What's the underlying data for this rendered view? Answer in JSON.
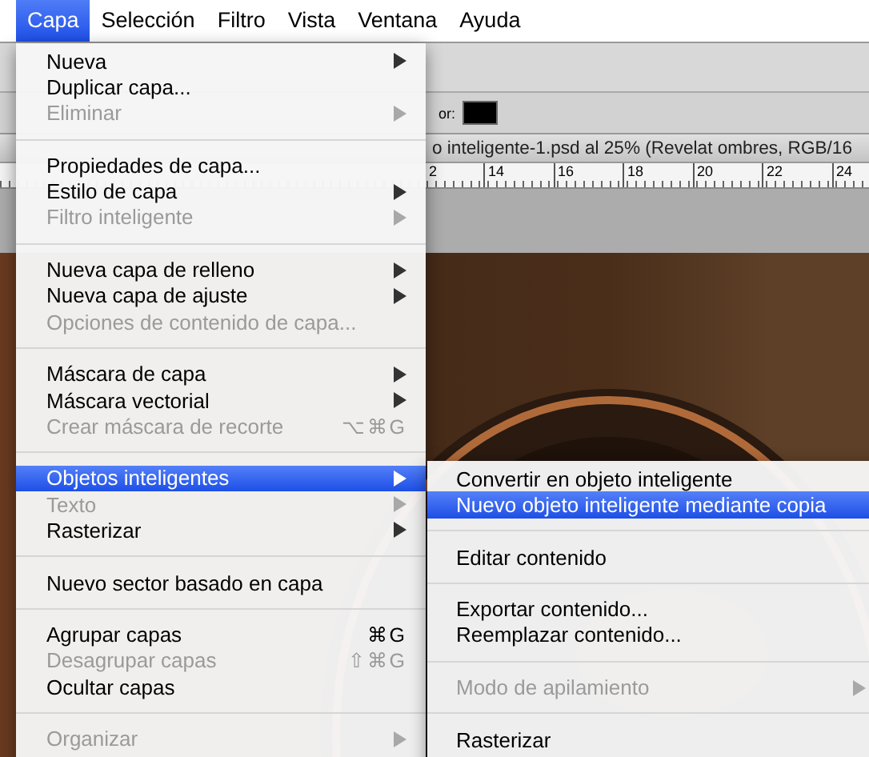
{
  "menu_bar": [
    {
      "label": "Capa",
      "selected": true
    },
    {
      "label": "Selección",
      "selected": false
    },
    {
      "label": "Filtro",
      "selected": false
    },
    {
      "label": "Vista",
      "selected": false
    },
    {
      "label": "Ventana",
      "selected": false
    },
    {
      "label": "Ayuda",
      "selected": false
    }
  ],
  "document": {
    "options_label": "or:",
    "title": "o inteligente-1.psd al 25% (Revelat ombres, RGB/16",
    "ruler_ticks": [
      "2",
      "14",
      "16",
      "18",
      "20",
      "22",
      "24"
    ]
  },
  "menu": {
    "items": [
      {
        "kind": "item",
        "label": "Nueva",
        "disabled": false,
        "submenu": true,
        "selected": false
      },
      {
        "kind": "item",
        "label": "Duplicar capa...",
        "disabled": false,
        "submenu": false,
        "selected": false
      },
      {
        "kind": "item",
        "label": "Eliminar",
        "disabled": true,
        "submenu": true,
        "selected": false
      },
      {
        "kind": "separator"
      },
      {
        "kind": "item",
        "label": "Propiedades de capa...",
        "disabled": false,
        "submenu": false,
        "selected": false
      },
      {
        "kind": "item",
        "label": "Estilo de capa",
        "disabled": false,
        "submenu": true,
        "selected": false
      },
      {
        "kind": "item",
        "label": "Filtro inteligente",
        "disabled": true,
        "submenu": true,
        "selected": false
      },
      {
        "kind": "separator"
      },
      {
        "kind": "item",
        "label": "Nueva capa de relleno",
        "disabled": false,
        "submenu": true,
        "selected": false
      },
      {
        "kind": "item",
        "label": "Nueva capa de ajuste",
        "disabled": false,
        "submenu": true,
        "selected": false
      },
      {
        "kind": "item",
        "label": "Opciones de contenido de capa...",
        "disabled": true,
        "submenu": false,
        "selected": false
      },
      {
        "kind": "separator"
      },
      {
        "kind": "item",
        "label": "Máscara de capa",
        "disabled": false,
        "submenu": true,
        "selected": false
      },
      {
        "kind": "item",
        "label": "Máscara vectorial",
        "disabled": false,
        "submenu": true,
        "selected": false
      },
      {
        "kind": "item",
        "label": "Crear máscara de recorte",
        "disabled": true,
        "submenu": false,
        "selected": false,
        "shortcut": "⌥⌘G"
      },
      {
        "kind": "separator"
      },
      {
        "kind": "item",
        "label": "Objetos inteligentes",
        "disabled": false,
        "submenu": true,
        "selected": true
      },
      {
        "kind": "item",
        "label": "Texto",
        "disabled": true,
        "submenu": true,
        "selected": false
      },
      {
        "kind": "item",
        "label": "Rasterizar",
        "disabled": false,
        "submenu": true,
        "selected": false
      },
      {
        "kind": "separator"
      },
      {
        "kind": "item",
        "label": "Nuevo sector basado en capa",
        "disabled": false,
        "submenu": false,
        "selected": false
      },
      {
        "kind": "separator"
      },
      {
        "kind": "item",
        "label": "Agrupar capas",
        "disabled": false,
        "submenu": false,
        "selected": false,
        "shortcut": "⌘G"
      },
      {
        "kind": "item",
        "label": "Desagrupar capas",
        "disabled": true,
        "submenu": false,
        "selected": false,
        "shortcut": "⇧⌘G"
      },
      {
        "kind": "item",
        "label": "Ocultar capas",
        "disabled": false,
        "submenu": false,
        "selected": false
      },
      {
        "kind": "separator"
      },
      {
        "kind": "item",
        "label": "Organizar",
        "disabled": true,
        "submenu": true,
        "selected": false
      }
    ]
  },
  "submenu": {
    "items": [
      {
        "kind": "item",
        "label": "Convertir en objeto inteligente",
        "disabled": false,
        "submenu": false,
        "selected": false
      },
      {
        "kind": "item",
        "label": "Nuevo objeto inteligente mediante copia",
        "disabled": false,
        "submenu": false,
        "selected": true
      },
      {
        "kind": "separator"
      },
      {
        "kind": "item",
        "label": "Editar contenido",
        "disabled": false,
        "submenu": false,
        "selected": false
      },
      {
        "kind": "separator"
      },
      {
        "kind": "item",
        "label": "Exportar contenido...",
        "disabled": false,
        "submenu": false,
        "selected": false
      },
      {
        "kind": "item",
        "label": "Reemplazar contenido...",
        "disabled": false,
        "submenu": false,
        "selected": false
      },
      {
        "kind": "separator"
      },
      {
        "kind": "item",
        "label": "Modo de apilamiento",
        "disabled": true,
        "submenu": true,
        "selected": false
      },
      {
        "kind": "separator"
      },
      {
        "kind": "item",
        "label": "Rasterizar",
        "disabled": false,
        "submenu": false,
        "selected": false
      }
    ]
  }
}
